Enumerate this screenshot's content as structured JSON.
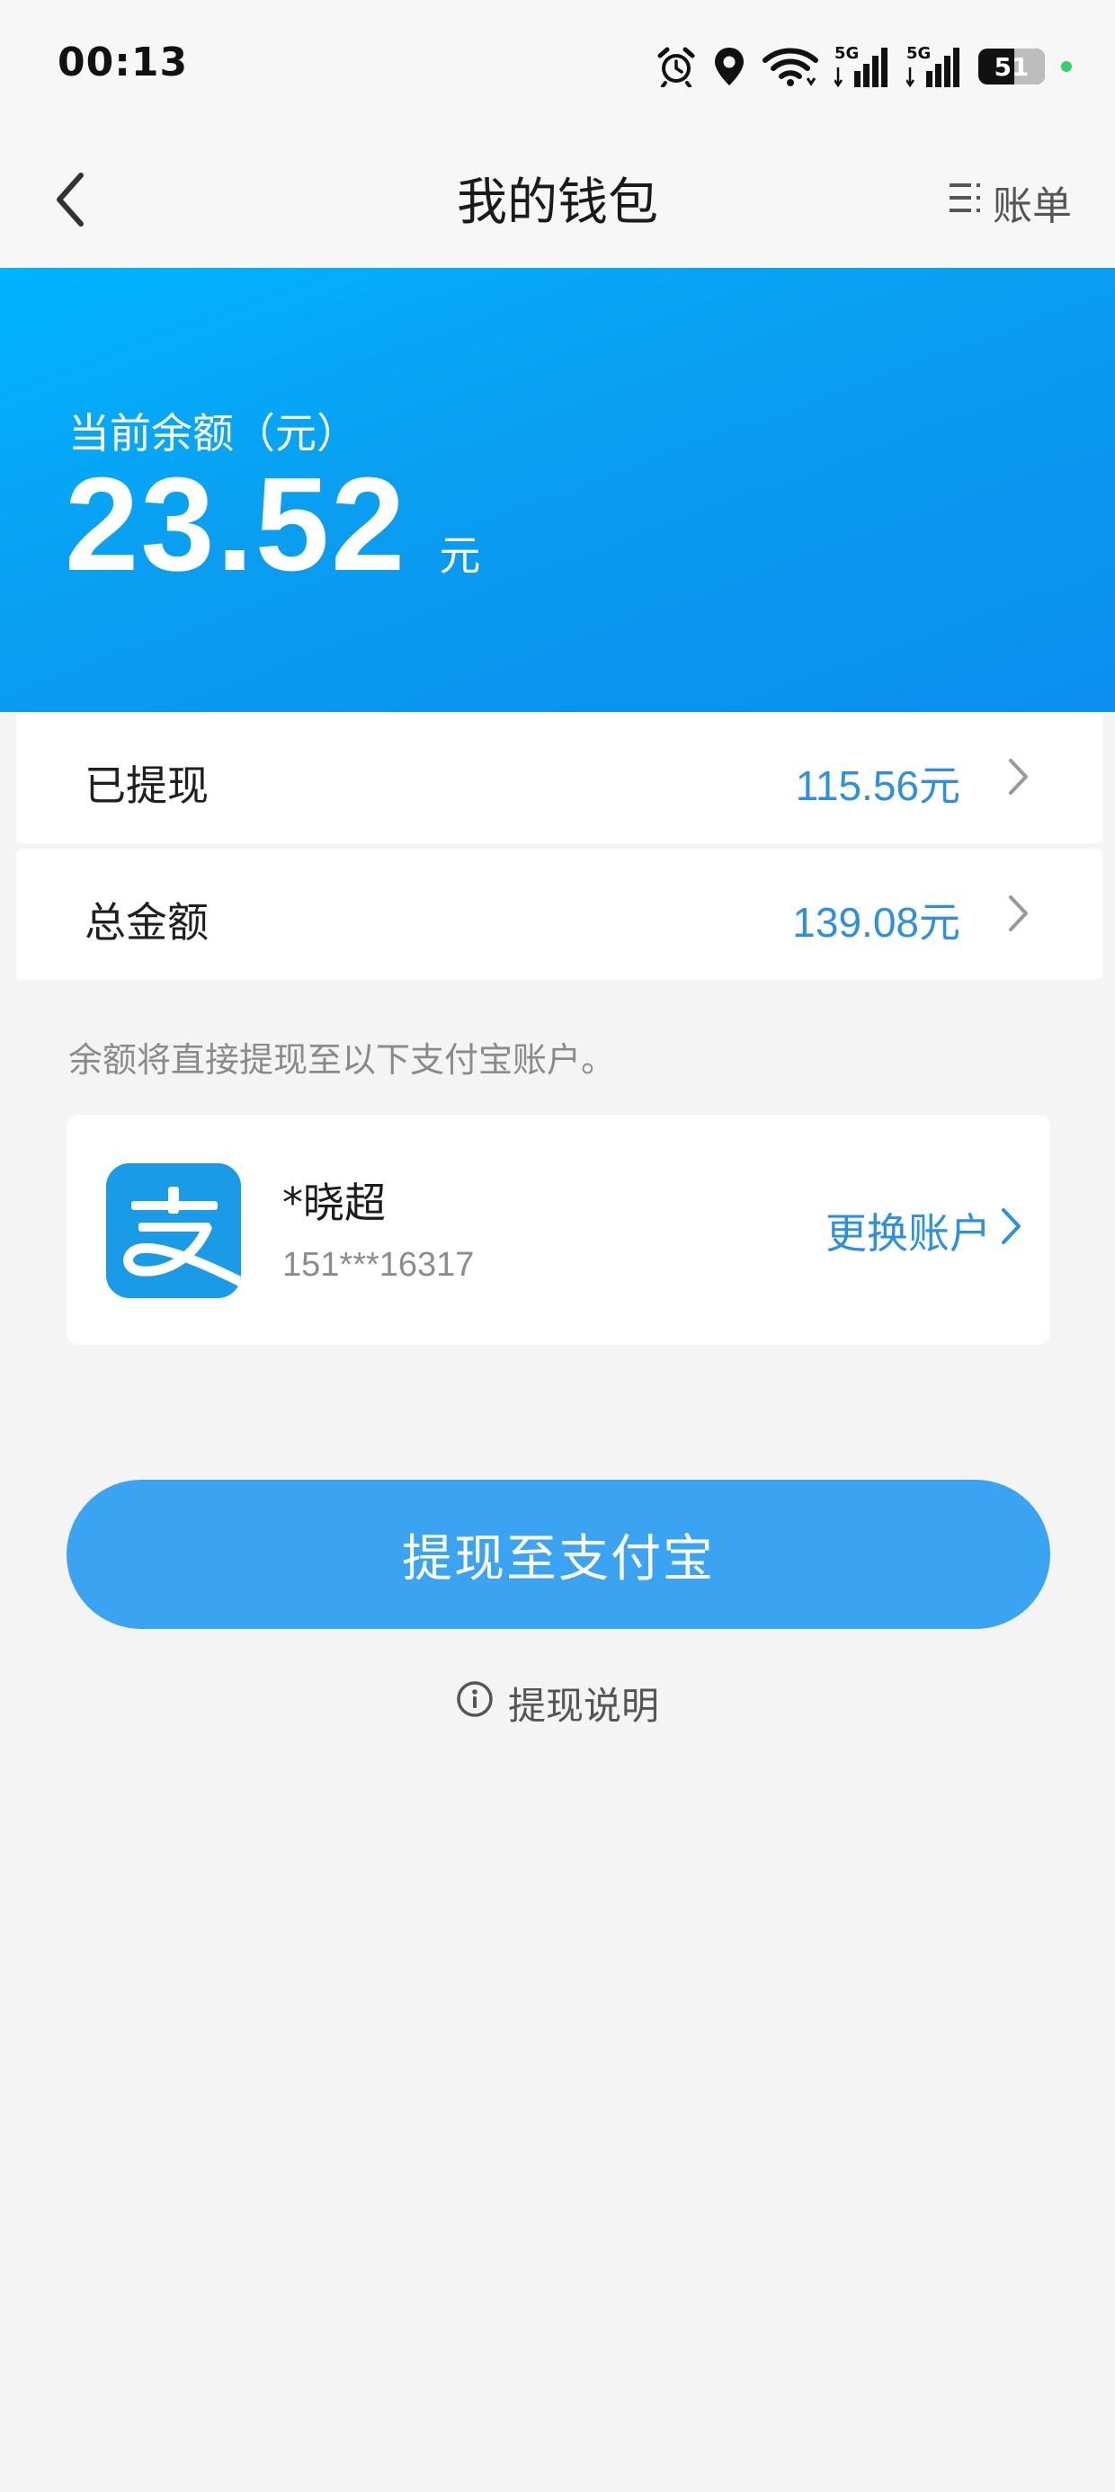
{
  "status_bar": {
    "time": "00:13",
    "network_label": "5G",
    "battery_level": "51",
    "icons": [
      "alarm-icon",
      "location-icon",
      "wifi-icon",
      "signal-5g-icon",
      "signal-5g-icon",
      "battery-icon",
      "charging-dot-icon"
    ]
  },
  "nav": {
    "title": "我的钱包",
    "bill_label": "账单",
    "back_icon": "chevron-left-icon",
    "bill_icon": "list-icon"
  },
  "balance": {
    "label": "当前余额（元）",
    "amount": "23.52",
    "unit": "元"
  },
  "summary": {
    "withdrawn": {
      "label": "已提现",
      "value": "115.56元"
    },
    "total": {
      "label": "总金额",
      "value": "139.08元"
    }
  },
  "notice": "余额将直接提现至以下支付宝账户。",
  "account": {
    "name": "*晓超",
    "phone": "151***16317",
    "change_label": "更换账户",
    "logo_icon": "alipay-logo-icon"
  },
  "actions": {
    "withdraw_label": "提现至支付宝",
    "instructions_label": "提现说明",
    "instructions_icon": "info-icon"
  },
  "colors": {
    "header_blue": "#0a9df0",
    "accent_blue": "#2e8fe0",
    "button_blue": "#3aa4f2",
    "page_bg": "#f4f4f4"
  }
}
